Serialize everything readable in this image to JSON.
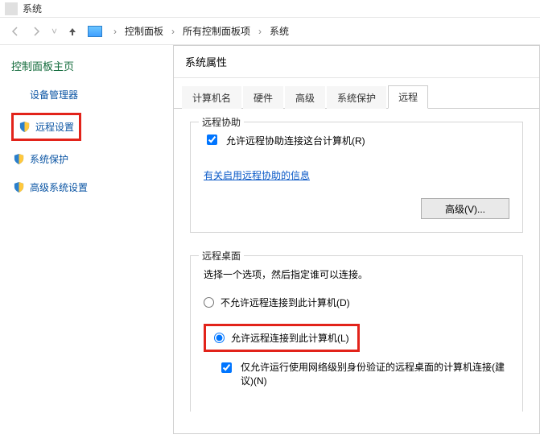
{
  "window": {
    "title": "系统"
  },
  "breadcrumb": {
    "a": "控制面板",
    "b": "所有控制面板项",
    "c": "系统"
  },
  "sidebar": {
    "home": "控制面板主页",
    "items": [
      {
        "label": "设备管理器"
      },
      {
        "label": "远程设置"
      },
      {
        "label": "系统保护"
      },
      {
        "label": "高级系统设置"
      }
    ]
  },
  "dialog": {
    "title": "系统属性",
    "tabs": [
      {
        "label": "计算机名"
      },
      {
        "label": "硬件"
      },
      {
        "label": "高级"
      },
      {
        "label": "系统保护"
      },
      {
        "label": "远程"
      }
    ],
    "selected_tab": 4,
    "remote_assist": {
      "legend": "远程协助",
      "chk_label": "允许远程协助连接这台计算机(R)",
      "help_link": "有关启用远程协助的信息",
      "advanced_btn": "高级(V)..."
    },
    "remote_desktop": {
      "legend": "远程桌面",
      "desc": "选择一个选项，然后指定谁可以连接。",
      "opt_disallow": "不允许远程连接到此计算机(D)",
      "opt_allow": "允许远程连接到此计算机(L)",
      "nla_chk": "仅允许运行使用网络级别身份验证的远程桌面的计算机连接(建议)(N)"
    }
  }
}
